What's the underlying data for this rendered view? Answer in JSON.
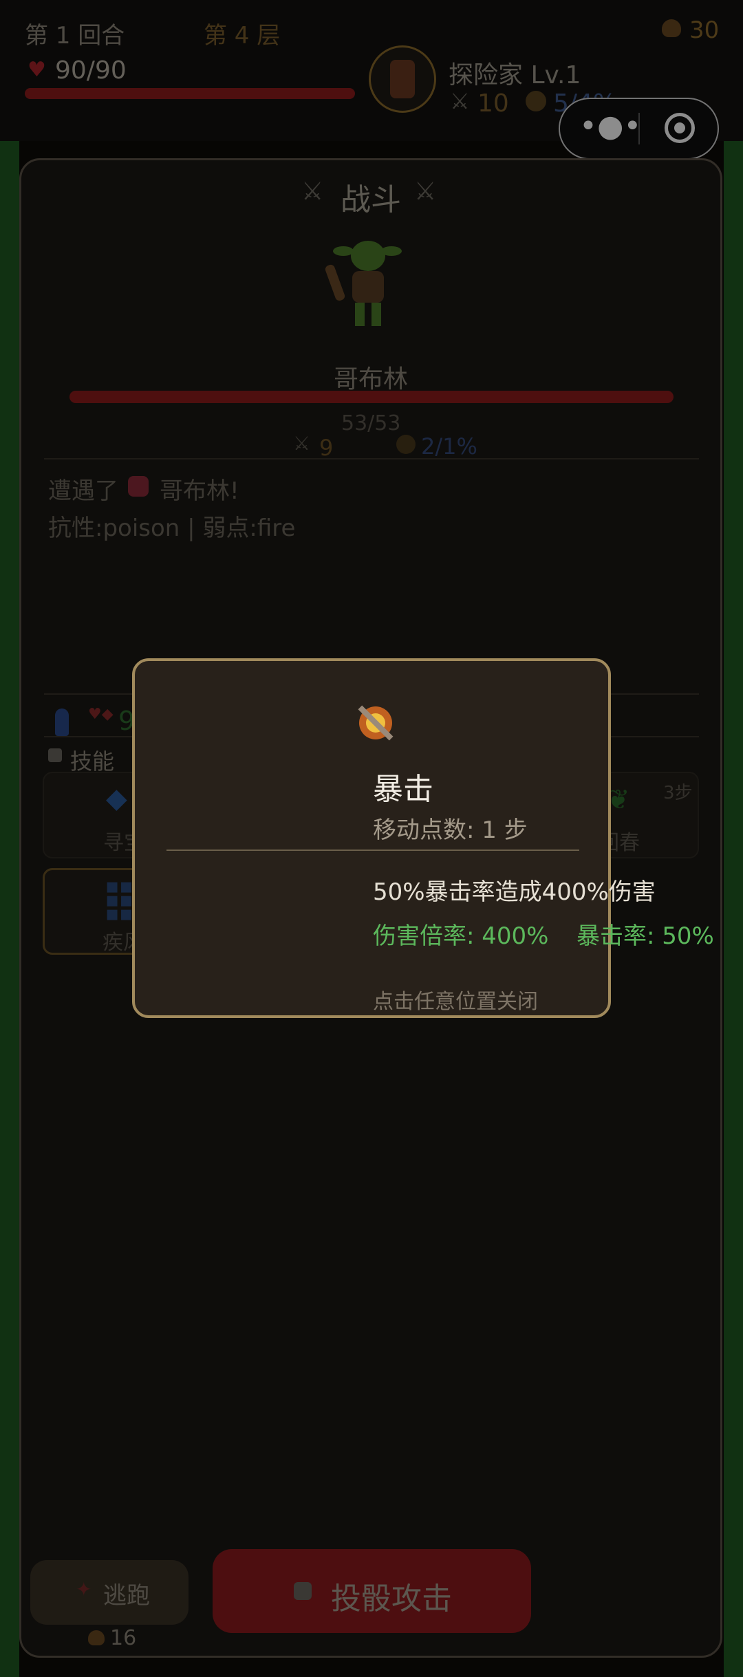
{
  "header": {
    "round": "第 1 回合",
    "floor": "第 4 层",
    "gold": "30",
    "player_hp": "90/90",
    "player_name": "探险家 Lv.1",
    "player_attack": "10",
    "player_crit": "5/4%"
  },
  "battle": {
    "title": "战斗",
    "enemy_name": "哥布林",
    "enemy_hp": "53/53",
    "enemy_attack": "9",
    "enemy_crit": "2/1%",
    "log": [
      "遭遇了",
      "哥布林!",
      "抗性:poison | 弱点:fire"
    ]
  },
  "status_bar": {
    "partial_value": "9"
  },
  "skills": {
    "section_label": "技能",
    "cards": [
      {
        "label": "寻宝",
        "icon": "diamond-icon"
      },
      {
        "label": "回春",
        "icon": "leaf-icon",
        "cost": "3步"
      },
      {
        "label": "疾风",
        "icon": "wind-icon"
      }
    ]
  },
  "modal": {
    "title": "暴击",
    "move_points": "移动点数: 1 步",
    "description": "50%暴击率造成400%伤害",
    "damage_multiplier": "伤害倍率: 400%",
    "crit_rate": "暴击率: 50%",
    "close_hint": "点击任意位置关闭"
  },
  "actions": {
    "flee_label": "逃跑",
    "flee_cost": "16",
    "attack_label": "投骰攻击"
  },
  "colors": {
    "hp_red": "#8e1d1d",
    "gold_text": "#b48a40",
    "blue_text": "#5b7fbf",
    "green_text": "#5cb85c",
    "modal_border": "#a18a5c"
  }
}
